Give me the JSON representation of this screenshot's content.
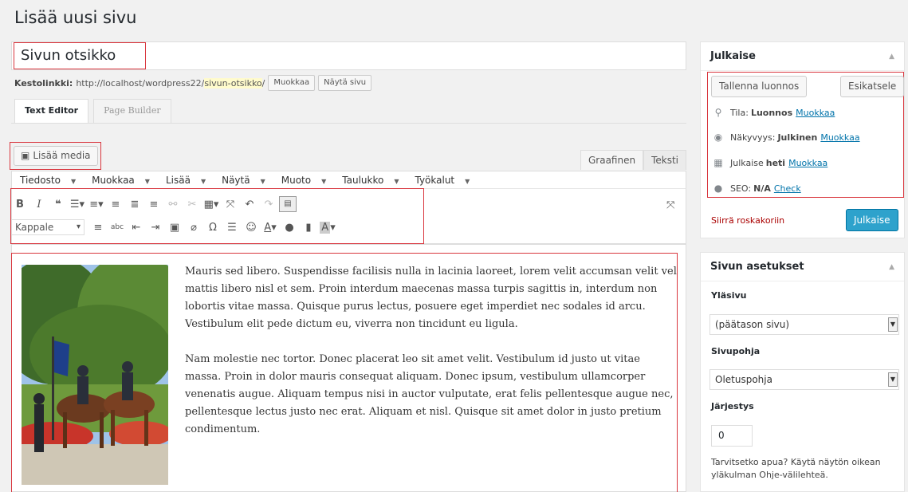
{
  "page_title": "Lisää uusi sivu",
  "title_value": "Sivun otsikko",
  "permalink": {
    "label": "Kestolinkki:",
    "base_url": "http://localhost/wordpress22/",
    "slug": "sivun-otsikko",
    "suffix": "/",
    "edit_btn": "Muokkaa",
    "view_btn": "Näytä sivu"
  },
  "editor_tabs": [
    "Text Editor",
    "Page Builder"
  ],
  "add_media": "Lisää media",
  "mode_tabs": {
    "visual": "Graafinen",
    "text": "Teksti"
  },
  "menubar": [
    "Tiedosto",
    "Muokkaa",
    "Lisää",
    "Näytä",
    "Muoto",
    "Taulukko",
    "Työkalut"
  ],
  "format_select": "Kappale",
  "content": {
    "p1": "Mauris sed libero. Suspendisse facilisis nulla in lacinia laoreet, lorem velit accumsan velit vel mattis libero nisl et sem. Proin interdum maecenas massa turpis sagittis in, interdum non lobortis vitae massa. Quisque purus lectus, posuere eget imperdiet nec sodales id arcu. Vestibulum elit pede dictum eu, viverra non tincidunt eu ligula.",
    "p2": "Nam molestie nec tortor. Donec placerat leo sit amet velit. Vestibulum id justo ut vitae massa. Proin in dolor mauris consequat aliquam. Donec ipsum, vestibulum ullamcorper venenatis augue. Aliquam tempus nisi in auctor vulputate, erat felis pellentesque augue nec, pellentesque lectus justo nec erat. Aliquam et nisl. Quisque sit amet dolor in justo pretium condimentum."
  },
  "publish": {
    "title": "Julkaise",
    "save_draft": "Tallenna luonnos",
    "preview": "Esikatsele",
    "status_label": "Tila:",
    "status_value": "Luonnos",
    "visibility_label": "Näkyvyys:",
    "visibility_value": "Julkinen",
    "schedule_label": "Julkaise",
    "schedule_value": "heti",
    "seo_label": "SEO:",
    "seo_value": "N/A",
    "seo_link": "Check",
    "edit_link": "Muokkaa",
    "trash": "Siirrä roskakoriin",
    "publish_btn": "Julkaise"
  },
  "settings": {
    "title": "Sivun asetukset",
    "parent_label": "Yläsivu",
    "parent_value": "(päätason sivu)",
    "template_label": "Sivupohja",
    "template_value": "Oletuspohja",
    "order_label": "Järjestys",
    "order_value": "0",
    "help": "Tarvitsetko apua? Käytä näytön oikean yläkulman Ohje-välilehteä."
  }
}
